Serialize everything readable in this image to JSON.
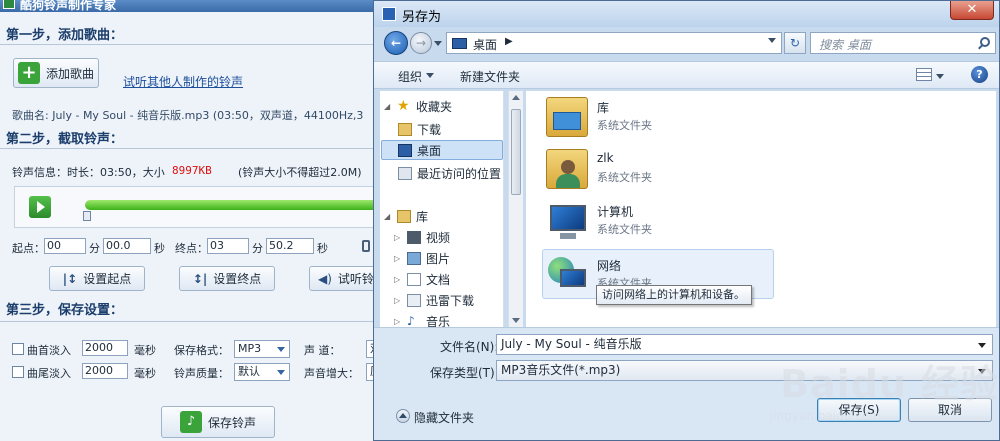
{
  "app": {
    "title": "酷狗铃声制作专家",
    "step1": {
      "heading": "第一步，添加歌曲：",
      "add_button": "添加歌曲",
      "preview_link": "试听其他人制作的铃声",
      "song_info": "歌曲名: July - My Soul - 纯音乐版.mp3    (03:50，双声道，44100Hz,3"
    },
    "step2": {
      "heading": "第二步，截取铃声：",
      "info_label": "铃声信息：时长：03:50，大小",
      "info_size": "8997KB",
      "info_note": "(铃声大小不得超过2.0M)",
      "progress": 0.0,
      "start_label": "起点：",
      "start_min": "00",
      "start_sec": "00.0",
      "end_label": "终点：",
      "end_min": "03",
      "end_sec": "50.2",
      "min_unit": "分",
      "sec_unit": "秒",
      "set_start": "设置起点",
      "set_end": "设置终点",
      "preview": "试听铃"
    },
    "step3": {
      "heading": "第三步，保存设置：",
      "fade_in": "曲首淡入",
      "fade_in_val": "2000",
      "fade_out": "曲尾淡入",
      "fade_out_val": "2000",
      "ms": "毫秒",
      "format_label": "保存格式：",
      "format_val": "MP3",
      "quality_label": "铃声质量：",
      "quality_val": "默认",
      "channel_label": "声        道：",
      "channel_val": "双",
      "volume_label": "声音增大：",
      "volume_val": "原",
      "save_button": "保存铃声"
    }
  },
  "dialog": {
    "title": "另存为",
    "close": "✕",
    "address": "桌面",
    "search_placeholder": "搜索 桌面",
    "toolbar": {
      "organize": "组织",
      "new_folder": "新建文件夹"
    },
    "nav": [
      {
        "label": "收藏夹",
        "icon": "star-icon"
      },
      {
        "label": "下载",
        "icon": "download-folder-icon"
      },
      {
        "label": "桌面",
        "icon": "desktop-icon",
        "selected": true
      },
      {
        "label": "最近访问的位置",
        "icon": "recent-places-icon"
      },
      {
        "label": "库",
        "icon": "library-icon"
      },
      {
        "label": "视频",
        "icon": "video-library-icon"
      },
      {
        "label": "图片",
        "icon": "picture-library-icon"
      },
      {
        "label": "文档",
        "icon": "document-library-icon"
      },
      {
        "label": "迅雷下载",
        "icon": "thunder-download-icon"
      },
      {
        "label": "音乐",
        "icon": "music-library-icon"
      }
    ],
    "items": [
      {
        "name": "库",
        "type": "系统文件夹",
        "icon": "library-folder-icon"
      },
      {
        "name": "zlk",
        "type": "系统文件夹",
        "icon": "user-folder-icon"
      },
      {
        "name": "计算机",
        "type": "系统文件夹",
        "icon": "computer-icon"
      },
      {
        "name": "网络",
        "type": "系统文件夹",
        "icon": "network-icon"
      }
    ],
    "tooltip": "访问网络上的计算机和设备。",
    "filename_label": "文件名(N):",
    "filename_value": "July - My Soul - 纯音乐版",
    "filetype_label": "保存类型(T):",
    "filetype_value": "MP3音乐文件(*.mp3)",
    "hide_folders": "隐藏文件夹",
    "save_button": "保存(S)",
    "cancel_button": "取消"
  },
  "watermark": {
    "line1": "Baidu 经验",
    "line2": "jingyan.baidu.com"
  }
}
